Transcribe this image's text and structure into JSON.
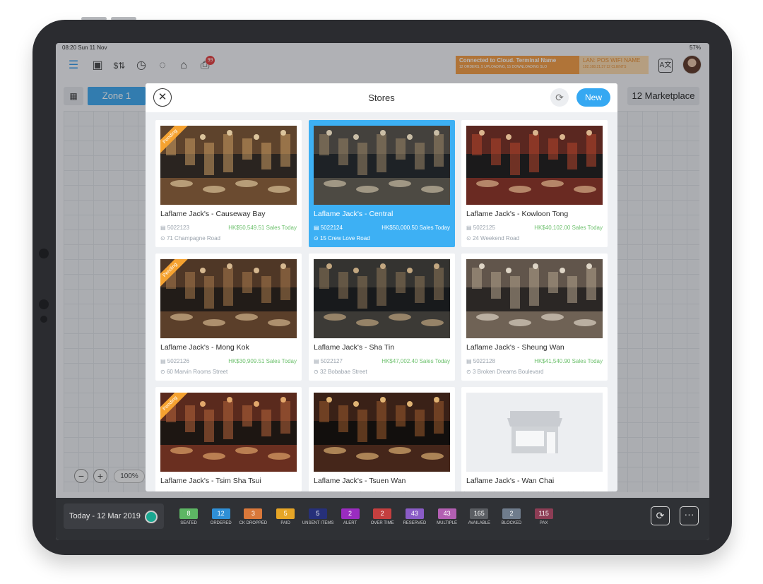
{
  "statusbar": {
    "time": "08:20  Sun 11 Nov",
    "battery": "57%"
  },
  "toolbar": {
    "notification_count": "99",
    "cloud_status": "Connected to Cloud. Terminal Name",
    "cloud_detail": "12 ORDERS, 5 UPLOADING, 15 DOWNLOADING SLO",
    "lan_status": "LAN: POS WIFI NAME",
    "lan_detail": "192.168.21.37  12 CLIENTS"
  },
  "zonebar": {
    "zone_label": "Zone 1",
    "marketplace_label": "12 Marketplace"
  },
  "zoom": {
    "minus": "−",
    "plus": "+",
    "percent": "100%"
  },
  "modal": {
    "title": "Stores",
    "new_label": "New",
    "pending_label": "Pending",
    "stores": [
      {
        "name": "Laflame Jack's - Causeway Bay",
        "code": "5022123",
        "sales": "HK$50,549.51 Sales Today",
        "address": "71 Champagne Road",
        "pending": true,
        "selected": false
      },
      {
        "name": "Laflame Jack's - Central",
        "code": "5022124",
        "sales": "HK$50,000.50 Sales Today",
        "address": "15 Crew Love Road",
        "pending": false,
        "selected": true
      },
      {
        "name": "Laflame Jack's - Kowloon Tong",
        "code": "5022125",
        "sales": "HK$40,102.00 Sales Today",
        "address": "24 Weekend Road",
        "pending": false,
        "selected": false
      },
      {
        "name": "Laflame Jack's - Mong Kok",
        "code": "5022126",
        "sales": "HK$30,909.51 Sales Today",
        "address": "60 Marvin Rooms Street",
        "pending": true,
        "selected": false
      },
      {
        "name": "Laflame Jack's - Sha Tin",
        "code": "5022127",
        "sales": "HK$47,002.40 Sales Today",
        "address": "32 Bobabae Street",
        "pending": false,
        "selected": false
      },
      {
        "name": "Laflame Jack's - Sheung Wan",
        "code": "5022128",
        "sales": "HK$41,540.90 Sales Today",
        "address": "3 Broken Dreams Boulevard",
        "pending": false,
        "selected": false
      },
      {
        "name": "Laflame Jack's - Tsim Sha Tsui",
        "pending": true,
        "selected": false
      },
      {
        "name": "Laflame Jack's - Tsuen Wan",
        "pending": false,
        "selected": false
      },
      {
        "name": "Laflame Jack's - Wan Chai",
        "pending": false,
        "selected": false
      }
    ]
  },
  "bottombar": {
    "date": "Today - 12 Mar 2019",
    "statuses": [
      {
        "count": "8",
        "label": "SEATED",
        "color": "#5db664"
      },
      {
        "count": "12",
        "label": "ORDERED",
        "color": "#2f8fd6"
      },
      {
        "count": "3",
        "label": "CK DROPPED",
        "color": "#d9783a"
      },
      {
        "count": "5",
        "label": "PAID",
        "color": "#e6a526"
      },
      {
        "count": "5",
        "label": "UNSENT ITEMS",
        "color": "#26307a"
      },
      {
        "count": "2",
        "label": "ALERT",
        "color": "#9a2cc0"
      },
      {
        "count": "2",
        "label": "OVER TIME",
        "color": "#c43f3f"
      },
      {
        "count": "43",
        "label": "RESERVED",
        "color": "#8a5cc6"
      },
      {
        "count": "43",
        "label": "MULTIPLE",
        "color": "#b25fb2"
      },
      {
        "count": "165",
        "label": "AVAILABLE",
        "color": "#5b5e63"
      },
      {
        "count": "2",
        "label": "BLOCKED",
        "color": "#6f7c8c"
      },
      {
        "count": "115",
        "label": "PAX",
        "color": "#8d3d55"
      }
    ]
  }
}
